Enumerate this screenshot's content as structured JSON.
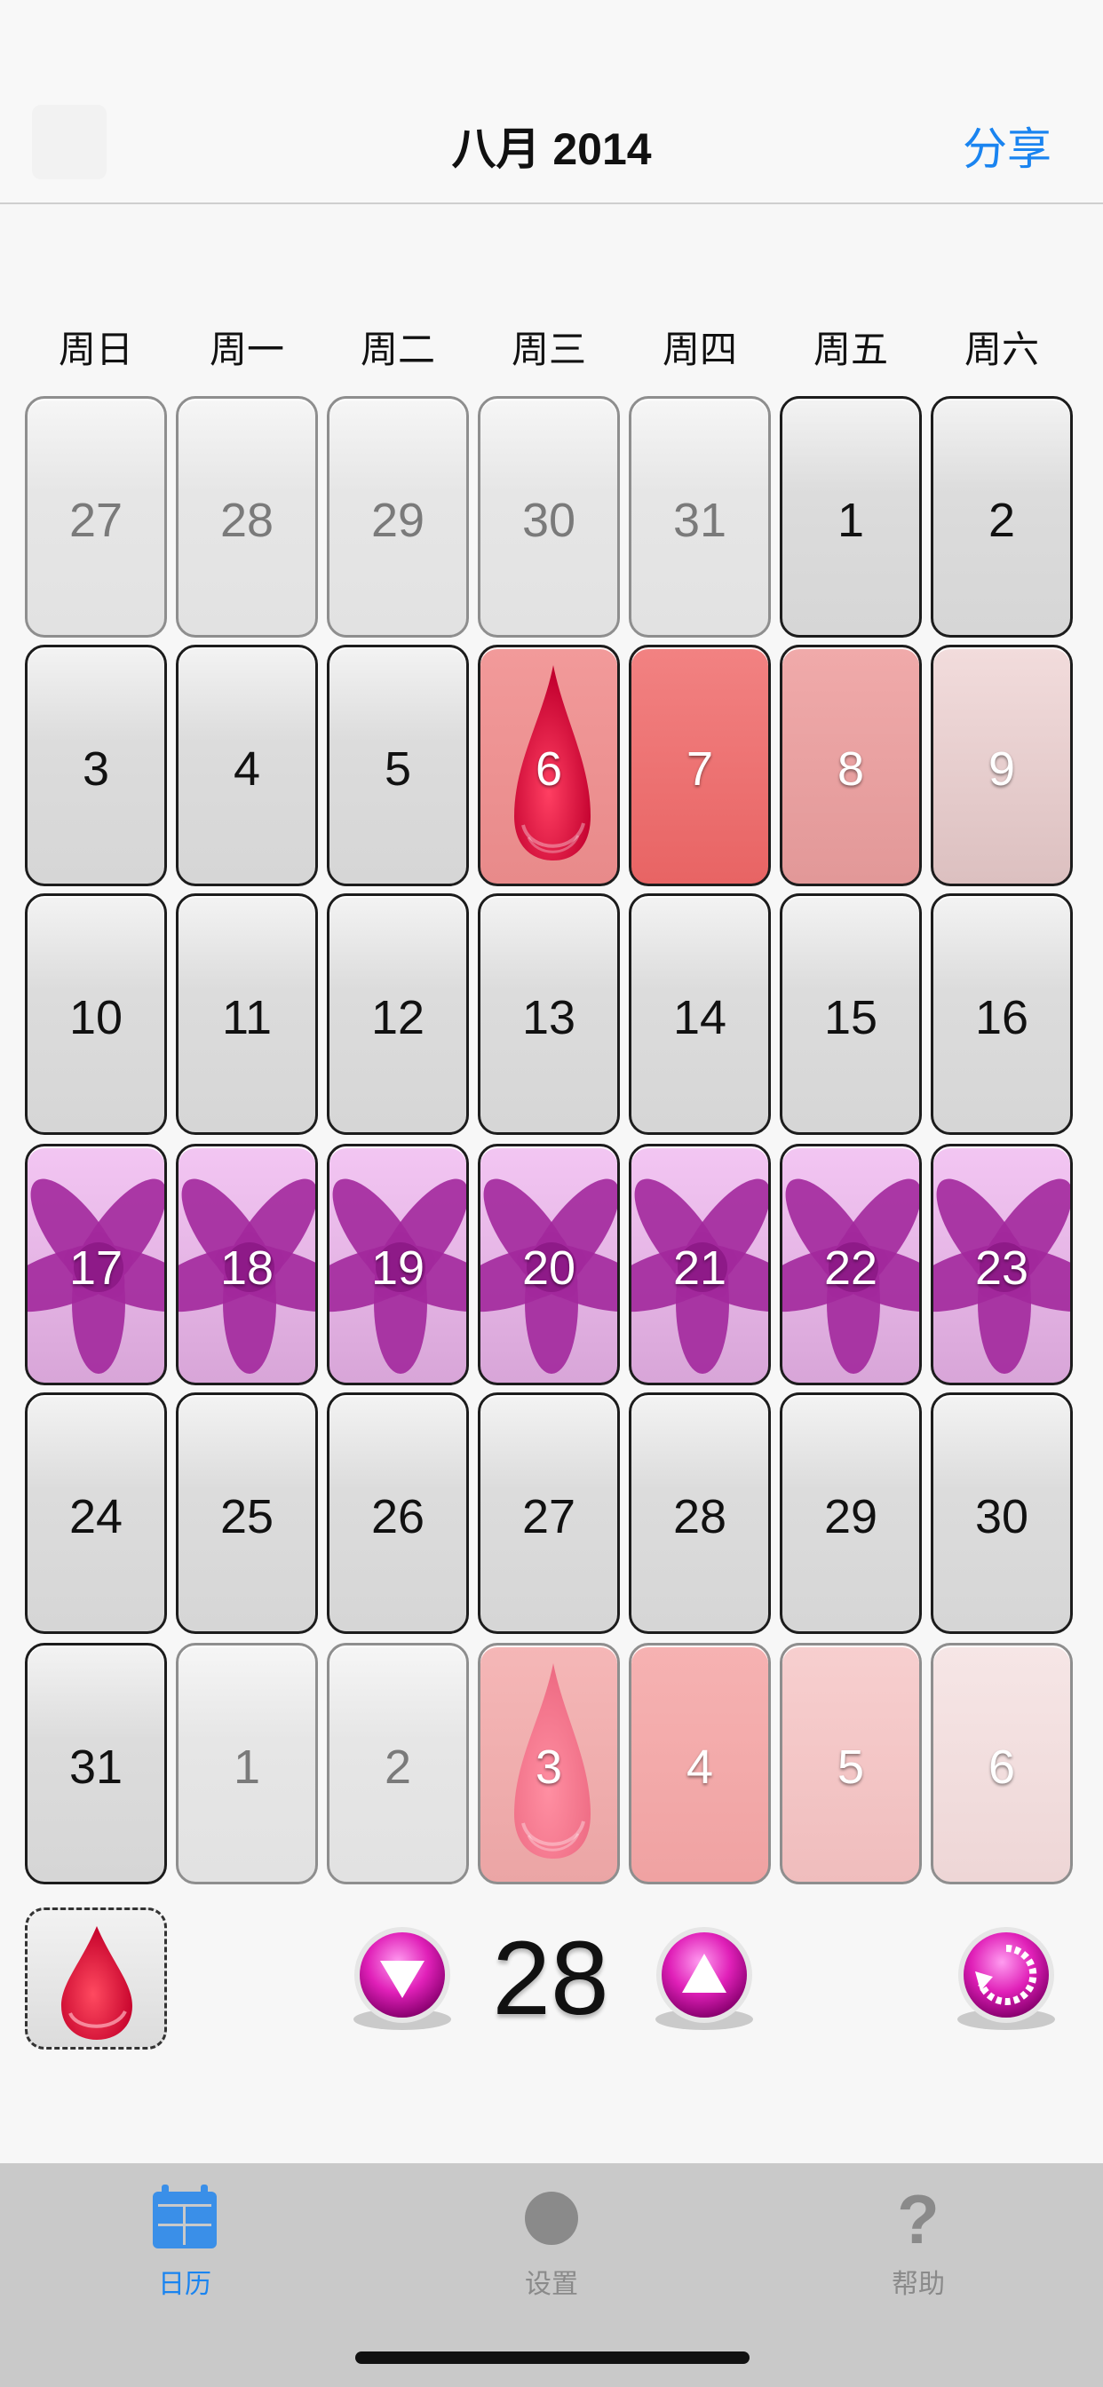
{
  "nav": {
    "title": "八月 2014",
    "share_label": "分享"
  },
  "weekdays": [
    "周日",
    "周一",
    "周二",
    "周三",
    "周四",
    "周五",
    "周六"
  ],
  "calendar": {
    "rows": [
      [
        {
          "day": "27",
          "state": "other-month"
        },
        {
          "day": "28",
          "state": "other-month"
        },
        {
          "day": "29",
          "state": "other-month"
        },
        {
          "day": "30",
          "state": "other-month"
        },
        {
          "day": "31",
          "state": "other-month"
        },
        {
          "day": "1",
          "state": "normal"
        },
        {
          "day": "2",
          "state": "normal"
        }
      ],
      [
        {
          "day": "3",
          "state": "normal"
        },
        {
          "day": "4",
          "state": "normal"
        },
        {
          "day": "5",
          "state": "normal"
        },
        {
          "day": "6",
          "state": "period-start"
        },
        {
          "day": "7",
          "state": "period"
        },
        {
          "day": "8",
          "state": "period"
        },
        {
          "day": "9",
          "state": "period"
        }
      ],
      [
        {
          "day": "10",
          "state": "normal"
        },
        {
          "day": "11",
          "state": "normal"
        },
        {
          "day": "12",
          "state": "normal"
        },
        {
          "day": "13",
          "state": "normal"
        },
        {
          "day": "14",
          "state": "normal"
        },
        {
          "day": "15",
          "state": "normal"
        },
        {
          "day": "16",
          "state": "normal"
        }
      ],
      [
        {
          "day": "17",
          "state": "fertile"
        },
        {
          "day": "18",
          "state": "fertile"
        },
        {
          "day": "19",
          "state": "fertile"
        },
        {
          "day": "20",
          "state": "fertile"
        },
        {
          "day": "21",
          "state": "fertile"
        },
        {
          "day": "22",
          "state": "fertile"
        },
        {
          "day": "23",
          "state": "fertile"
        }
      ],
      [
        {
          "day": "24",
          "state": "normal"
        },
        {
          "day": "25",
          "state": "normal"
        },
        {
          "day": "26",
          "state": "normal"
        },
        {
          "day": "27",
          "state": "normal"
        },
        {
          "day": "28",
          "state": "normal"
        },
        {
          "day": "29",
          "state": "normal"
        },
        {
          "day": "30",
          "state": "normal"
        }
      ],
      [
        {
          "day": "31",
          "state": "normal"
        },
        {
          "day": "1",
          "state": "other-month"
        },
        {
          "day": "2",
          "state": "other-month"
        },
        {
          "day": "3",
          "state": "predicted-period-start"
        },
        {
          "day": "4",
          "state": "predicted-period"
        },
        {
          "day": "5",
          "state": "predicted-period"
        },
        {
          "day": "6",
          "state": "predicted-period"
        }
      ]
    ]
  },
  "controls": {
    "cycle_length": "28",
    "mark_period_icon": "blood-drop-icon",
    "decrease_icon": "arrow-down-icon",
    "increase_icon": "arrow-up-icon",
    "reset_icon": "refresh-icon"
  },
  "tabs": [
    {
      "label": "日历",
      "icon": "calendar-icon",
      "active": true
    },
    {
      "label": "设置",
      "icon": "settings-circle-icon",
      "active": false
    },
    {
      "label": "帮助",
      "icon": "question-icon",
      "active": false
    }
  ],
  "colors": {
    "accent": "#1a84f0",
    "period": "#e86464",
    "fertile": "#a0239a",
    "button_magenta": "#e020b8"
  }
}
